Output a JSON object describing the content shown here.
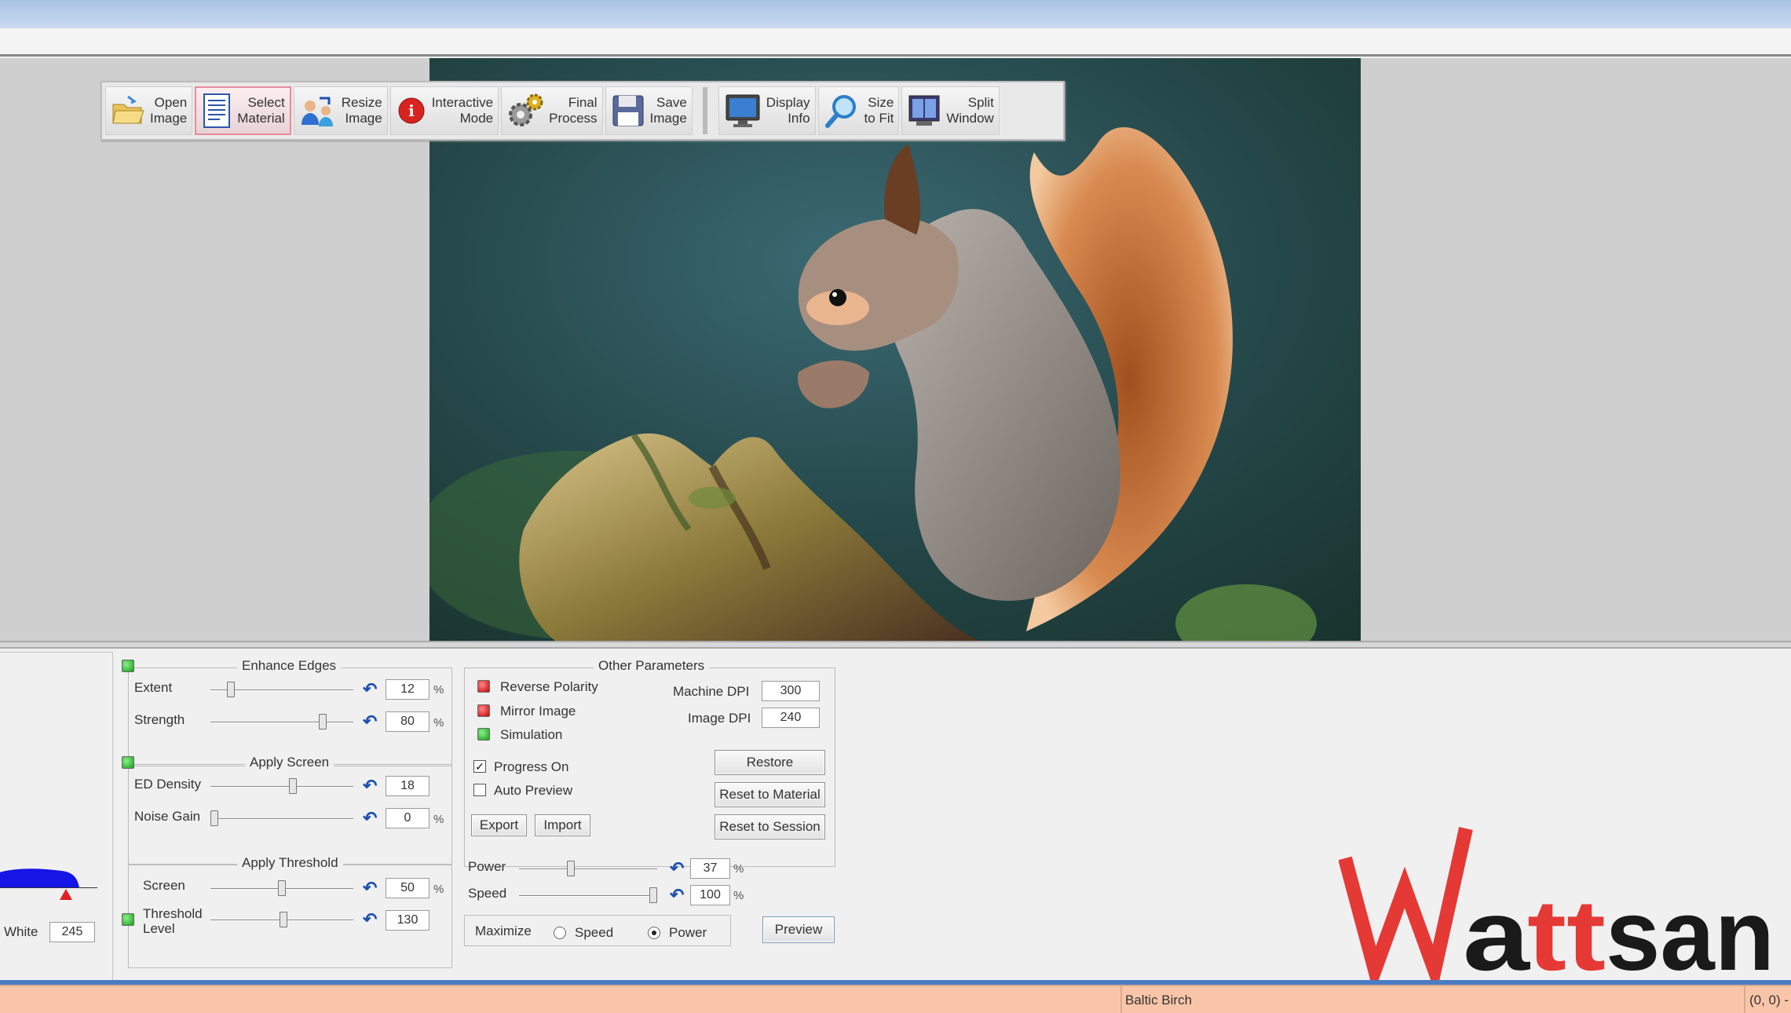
{
  "toolbar": {
    "buttons": [
      {
        "label": "Open\nImage",
        "icon": "folder-open-icon"
      },
      {
        "label": "Select\nMaterial",
        "icon": "document-list-icon",
        "selected": true
      },
      {
        "label": "Resize\nImage",
        "icon": "users-resize-icon"
      },
      {
        "label": "Interactive\nMode",
        "icon": "info-icon"
      },
      {
        "label": "Final\nProcess",
        "icon": "gears-icon"
      },
      {
        "label": "Save\nImage",
        "icon": "floppy-disk-icon"
      },
      {
        "label": "Display\nInfo",
        "icon": "monitor-icon"
      },
      {
        "label": "Size\nto Fit",
        "icon": "magnifier-icon"
      },
      {
        "label": "Split\nWindow",
        "icon": "split-window-icon"
      }
    ]
  },
  "canvas": {
    "subject": "squirrel-photo"
  },
  "histogram": {
    "white_label": "White",
    "white_value": "245"
  },
  "enhance_edges": {
    "title": "Enhance Edges",
    "enabled": true,
    "extent": {
      "label": "Extent",
      "value": "12",
      "unit": "%",
      "level": 0.12
    },
    "strength": {
      "label": "Strength",
      "value": "80",
      "unit": "%",
      "level": 0.8
    }
  },
  "apply_screen": {
    "title": "Apply Screen",
    "enabled": true,
    "ed_density": {
      "label": "ED Density",
      "value": "18",
      "level": 0.58
    },
    "noise_gain": {
      "label": "Noise Gain",
      "value": "0",
      "unit": "%",
      "level": 0.0
    }
  },
  "apply_threshold": {
    "title": "Apply Threshold",
    "screen": {
      "label": "Screen",
      "value": "50",
      "unit": "%",
      "level": 0.5
    },
    "threshold": {
      "label": "Threshold\nLevel",
      "value": "130",
      "level": 0.51,
      "enabled": true
    }
  },
  "other_parameters": {
    "title": "Other Parameters",
    "reverse_polarity": "Reverse Polarity",
    "mirror_image": "Mirror Image",
    "simulation": "Simulation",
    "machine_dpi_label": "Machine DPI",
    "machine_dpi": "300",
    "image_dpi_label": "Image DPI",
    "image_dpi": "240",
    "progress_on": "Progress On",
    "progress_on_checked": true,
    "auto_preview": "Auto Preview",
    "auto_preview_checked": false,
    "restore": "Restore",
    "reset_material": "Reset to Material",
    "reset_session": "Reset to Session",
    "export": "Export",
    "import": "Import"
  },
  "power": {
    "label": "Power",
    "value": "37",
    "unit": "%",
    "level": 0.37
  },
  "speed": {
    "label": "Speed",
    "value": "100",
    "unit": "%",
    "level": 1.0
  },
  "maximize": {
    "label": "Maximize",
    "opt_speed": "Speed",
    "opt_power": "Power",
    "selected": "Power"
  },
  "preview_button": "Preview",
  "status": {
    "material": "Baltic Birch",
    "coords": "(0, 0) -"
  },
  "logo": {
    "text": "Wattsan",
    "accent": "#e53935",
    "dark": "#1a1a1a"
  }
}
